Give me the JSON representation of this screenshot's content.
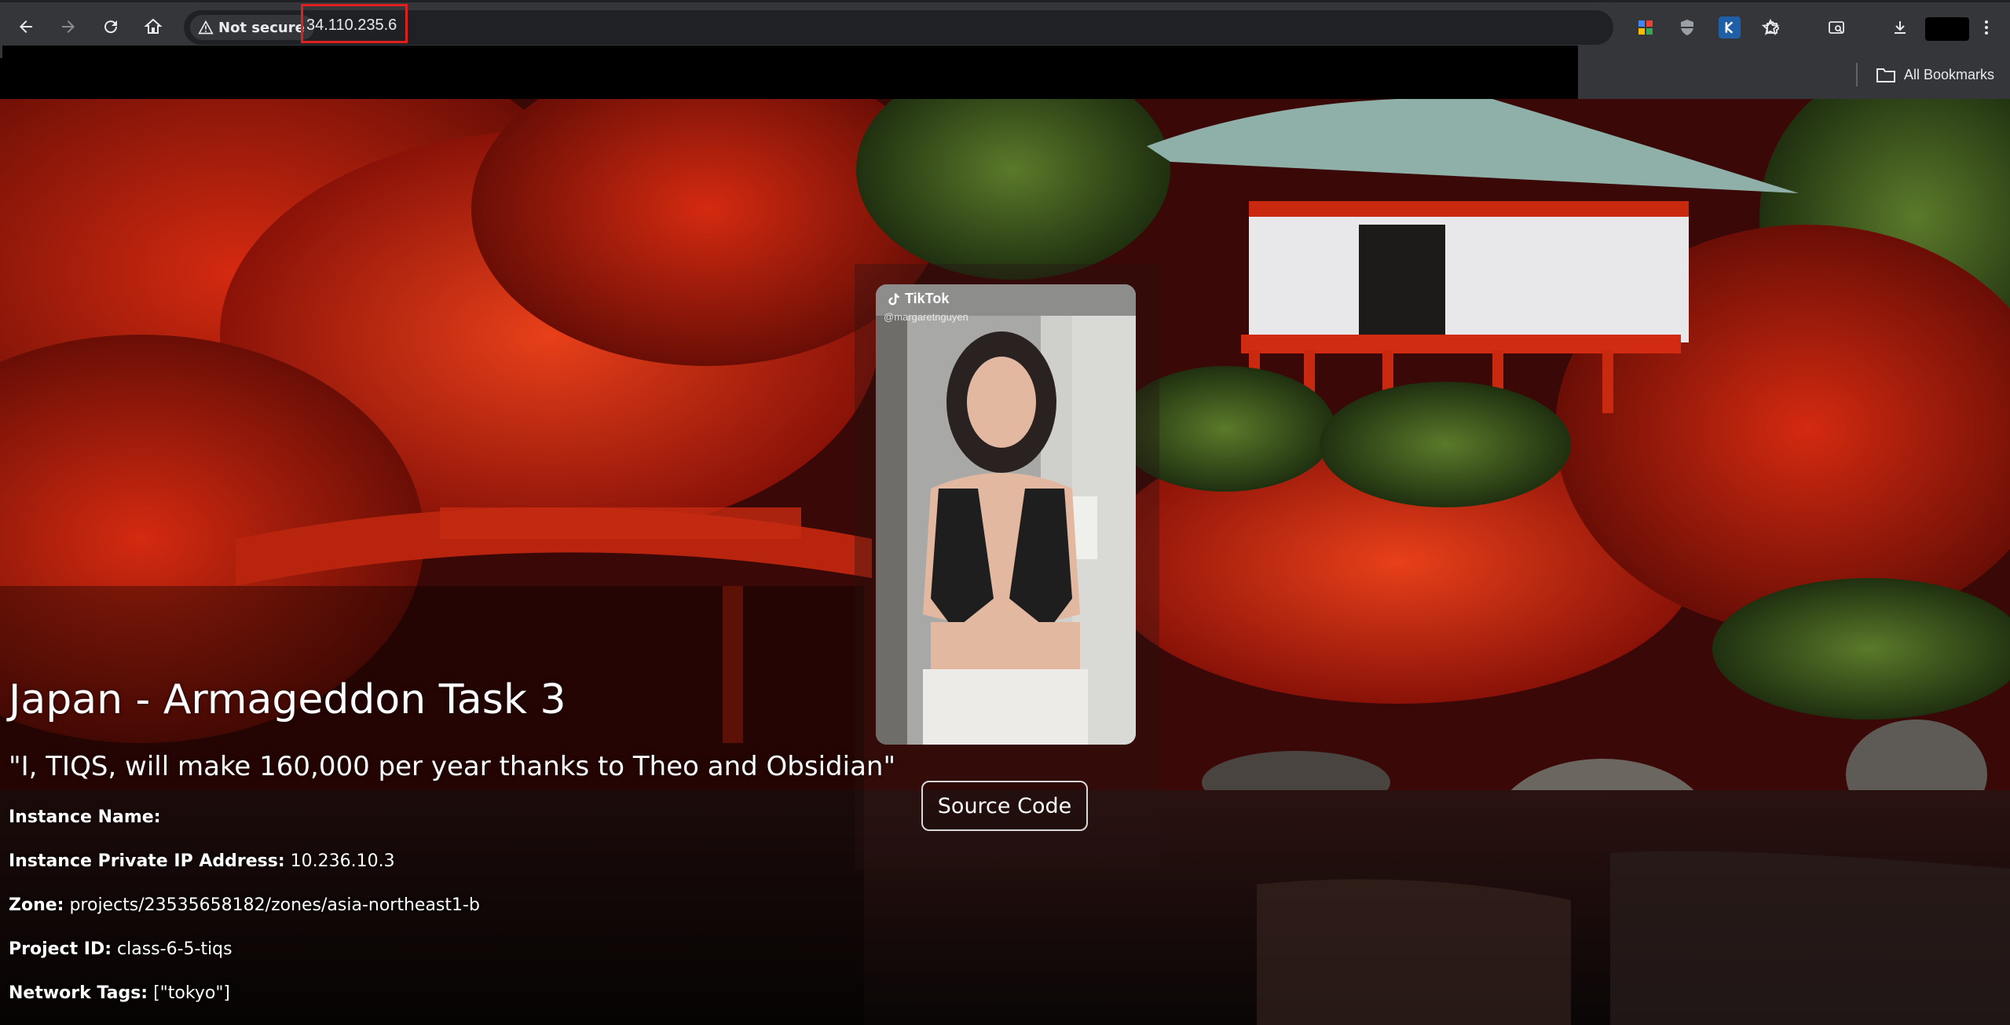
{
  "browser": {
    "security_label": "Not secure",
    "url": "34.110.235.6",
    "bookmarks_label": "All Bookmarks"
  },
  "media": {
    "brand": "TikTok",
    "username": "@margaretnguyen"
  },
  "page": {
    "title": "Japan - Armageddon Task 3",
    "quote": "\"I, TIQS, will make 160,000 per year thanks to Theo and Obsidian\"",
    "source_button": "Source Code",
    "info": {
      "instance_name_label": "Instance Name:",
      "instance_name_value": "",
      "private_ip_label": "Instance Private IP Address:",
      "private_ip_value": "10.236.10.3",
      "zone_label": "Zone:",
      "zone_value": "projects/23535658182/zones/asia-northeast1-b",
      "project_id_label": "Project ID:",
      "project_id_value": "class-6-5-tiqs",
      "network_tags_label": "Network Tags:",
      "network_tags_value": "[\"tokyo\"]"
    }
  },
  "colors": {
    "url_highlight": "#e0201e",
    "chrome_bg": "#35363a",
    "omnibox_bg": "#202124"
  }
}
